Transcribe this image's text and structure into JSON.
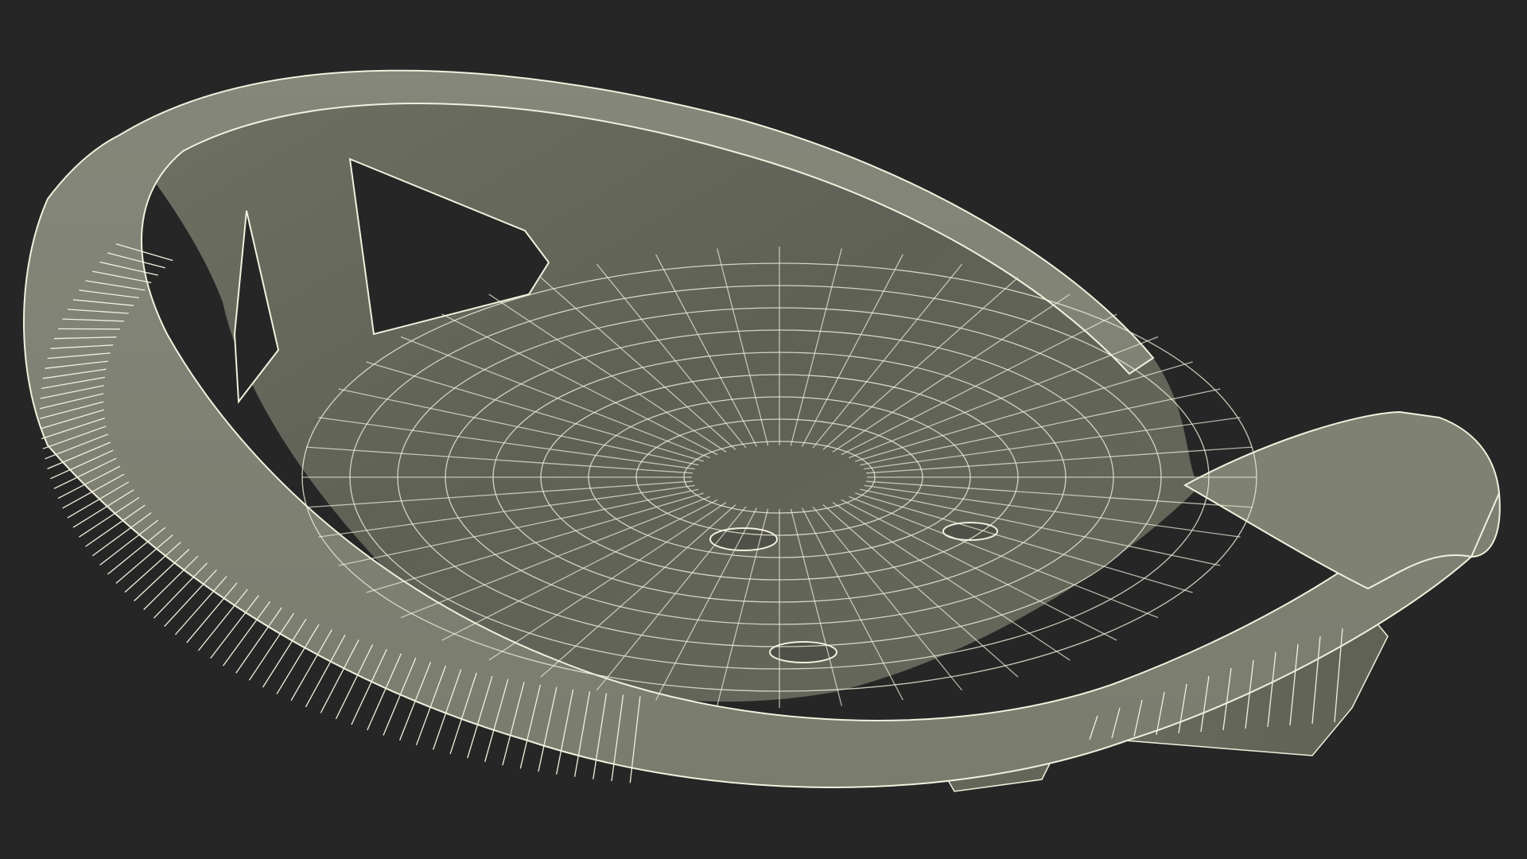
{
  "scene": {
    "subject_icon": "wireframe-seat-model",
    "colors": {
      "background": "#262626",
      "surface_light": "#7d7f70",
      "surface_mid": "#6b6d60",
      "surface_dark": "#5b5d52",
      "wire": "#f2f0de"
    }
  }
}
